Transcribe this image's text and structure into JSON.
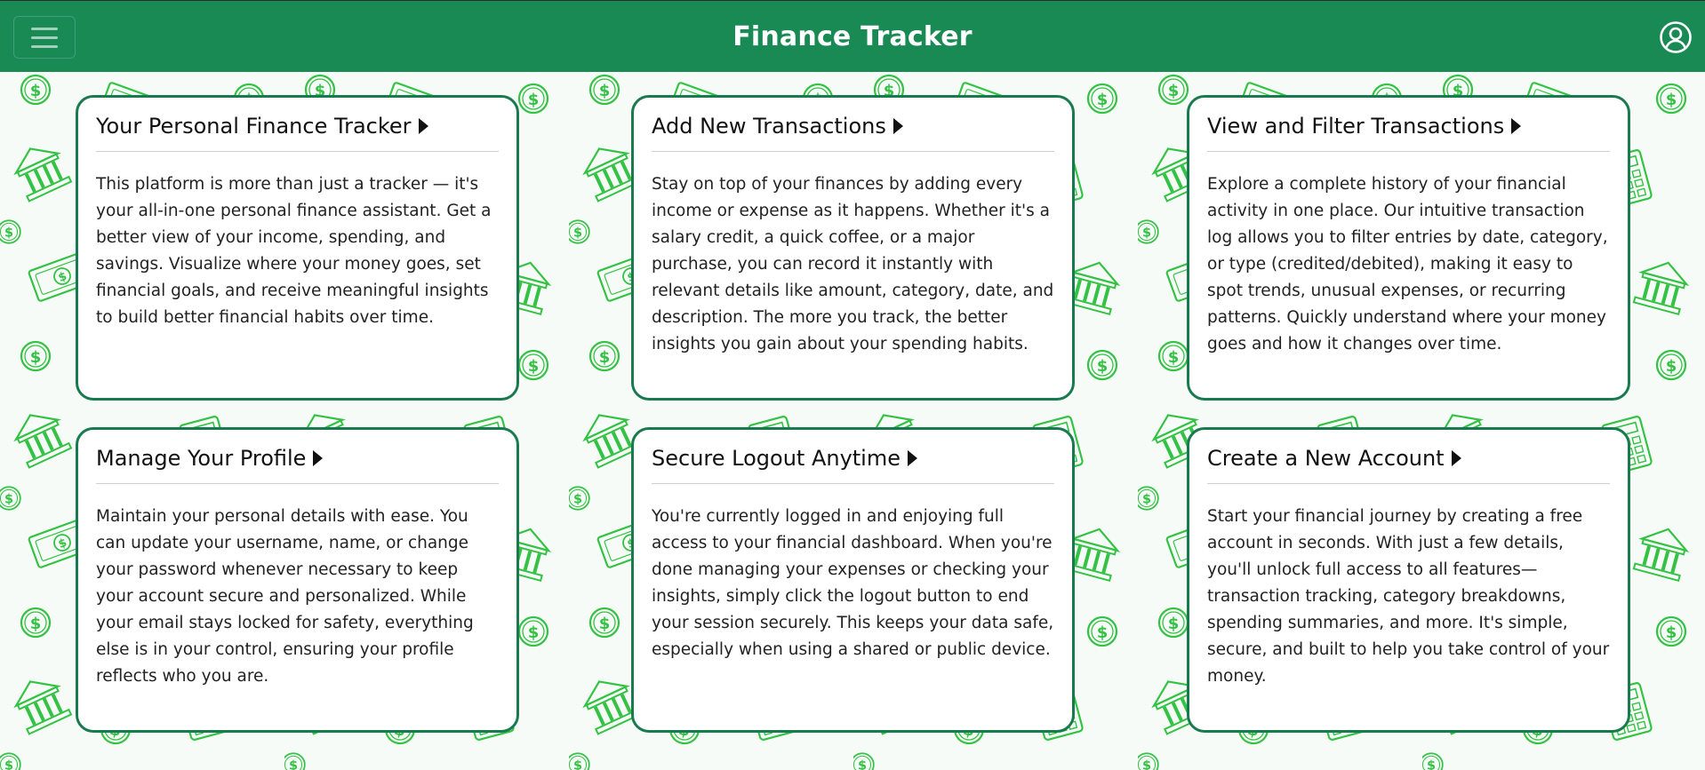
{
  "header": {
    "title": "Finance Tracker",
    "menu_icon": "hamburger-menu-icon",
    "user_icon": "user-account-icon",
    "background_color": "#1a8a55"
  },
  "background": {
    "pattern": "money-doodles",
    "icons": [
      "dollar-coin-icon",
      "bank-icon",
      "banknote-icon",
      "calculator-icon",
      "receipt-icon"
    ],
    "color": "#2fbf3f"
  },
  "cards": [
    {
      "title": "Your Personal Finance Tracker",
      "text": "This platform is more than just a tracker — it's your all-in-one personal finance assistant. Get a better view of your income, spending, and savings. Visualize where your money goes, set financial goals, and receive meaningful insights to build better financial habits over time."
    },
    {
      "title": "Add New Transactions",
      "text": "Stay on top of your finances by adding every income or expense as it happens. Whether it's a salary credit, a quick coffee, or a major purchase, you can record it instantly with relevant details like amount, category, date, and description. The more you track, the better insights you gain about your spending habits."
    },
    {
      "title": "View and Filter Transactions",
      "text": "Explore a complete history of your financial activity in one place. Our intuitive transaction log allows you to filter entries by date, category, or type (credited/debited), making it easy to spot trends, unusual expenses, or recurring patterns. Quickly understand where your money goes and how it changes over time."
    },
    {
      "title": "Manage Your Profile",
      "text": "Maintain your personal details with ease. You can update your username, name, or change your password whenever necessary to keep your account secure and personalized. While your email stays locked for safety, everything else is in your control, ensuring your profile reflects who you are."
    },
    {
      "title": "Secure Logout Anytime",
      "text": "You're currently logged in and enjoying full access to your financial dashboard. When you're done managing your expenses or checking your insights, simply click the logout button to end your session securely. This keeps your data safe, especially when using a shared or public device."
    },
    {
      "title": "Create a New Account",
      "text": "Start your financial journey by creating a free account in seconds. With just a few details, you'll unlock full access to all features—transaction tracking, category breakdowns, spending summaries, and more. It's simple, secure, and built to help you take control of your money."
    }
  ]
}
